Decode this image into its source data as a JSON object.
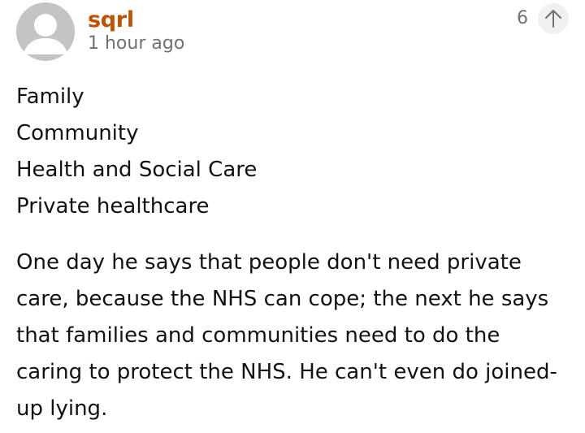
{
  "comment": {
    "author": "sqrl",
    "timestamp": "1 hour ago",
    "vote_count": "6",
    "lines": [
      "Family",
      "Community",
      "Health and Social Care",
      "Private healthcare"
    ],
    "paragraph": "One day he says that people don't need private care, because the NHS can cope; the next he says that families and communities need to do the caring to protect the NHS. He can't even do joined-up lying."
  },
  "icons": {
    "avatar": "default-user-avatar-icon",
    "upvote": "arrow-up-icon"
  },
  "colors": {
    "author": "#c05303",
    "meta": "#707070",
    "text": "#121212",
    "avatar_bg": "#c4c4c4",
    "upvote_bg": "#f0f0f0"
  }
}
